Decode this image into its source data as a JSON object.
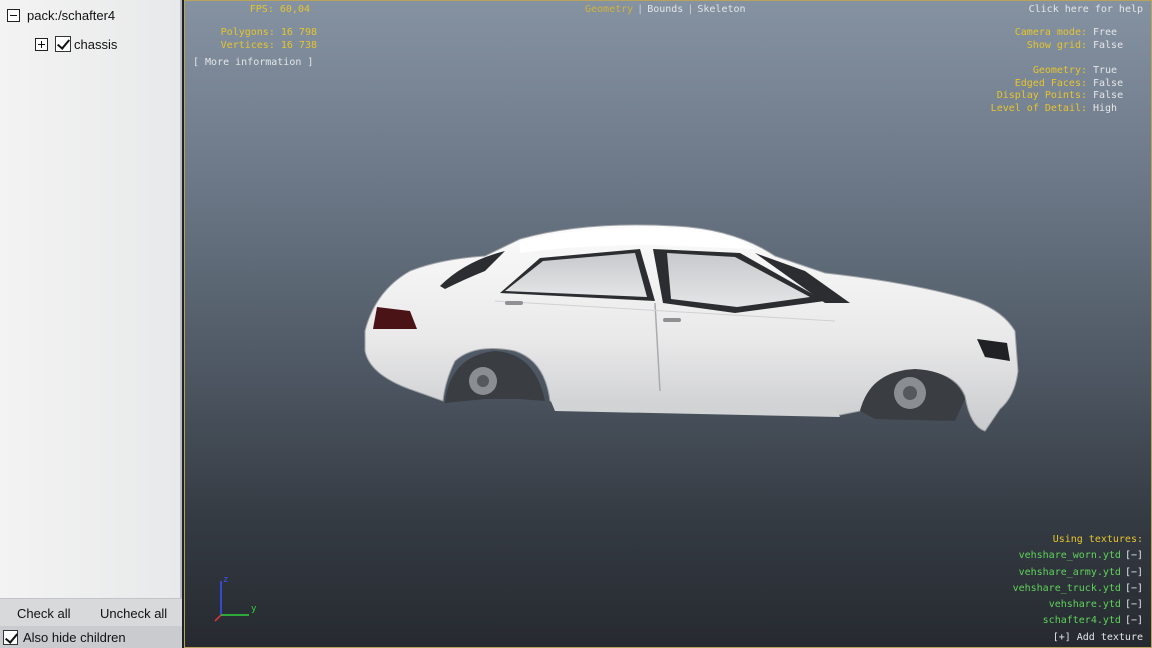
{
  "tree": {
    "root": {
      "label": "pack:/schafter4",
      "expanded": true
    },
    "child": {
      "label": "chassis",
      "expanded": false,
      "checked": true
    }
  },
  "bottom": {
    "check_all": "Check all",
    "uncheck_all": "Uncheck all",
    "also_hide_children": "Also hide children",
    "also_hide_children_checked": true
  },
  "hud": {
    "fps_label": "FPS:",
    "fps_value": "60,04",
    "polygons_label": "Polygons:",
    "polygons_value": "16 798",
    "vertices_label": "Vertices:",
    "vertices_value": "16 738",
    "more_info": "[ More information ]",
    "modes": [
      "Geometry",
      "Bounds",
      "Skeleton"
    ],
    "active_mode": "Geometry",
    "help": "Click here for help",
    "settings_group1": [
      {
        "label": "Camera mode:",
        "value": "Free"
      },
      {
        "label": "Show grid:",
        "value": "False"
      }
    ],
    "settings_group2": [
      {
        "label": "Geometry:",
        "value": "True"
      },
      {
        "label": "Edged Faces:",
        "value": "False"
      },
      {
        "label": "Display Points:",
        "value": "False"
      },
      {
        "label": "Level of Detail:",
        "value": "High"
      }
    ],
    "textures_title": "Using textures:",
    "textures": [
      "vehshare_worn.ytd",
      "vehshare_army.ytd",
      "vehshare_truck.ytd",
      "vehshare.ytd",
      "schafter4.ytd"
    ],
    "remove_label": "[−]",
    "add_texture": "[+] Add texture",
    "axis_z": "z",
    "axis_y": "y"
  },
  "colors": {
    "hud_label": "#e6c52c",
    "hud_value": "#e4e6e8",
    "texture": "#5fd25b",
    "viewport_border": "#b7a35b"
  }
}
